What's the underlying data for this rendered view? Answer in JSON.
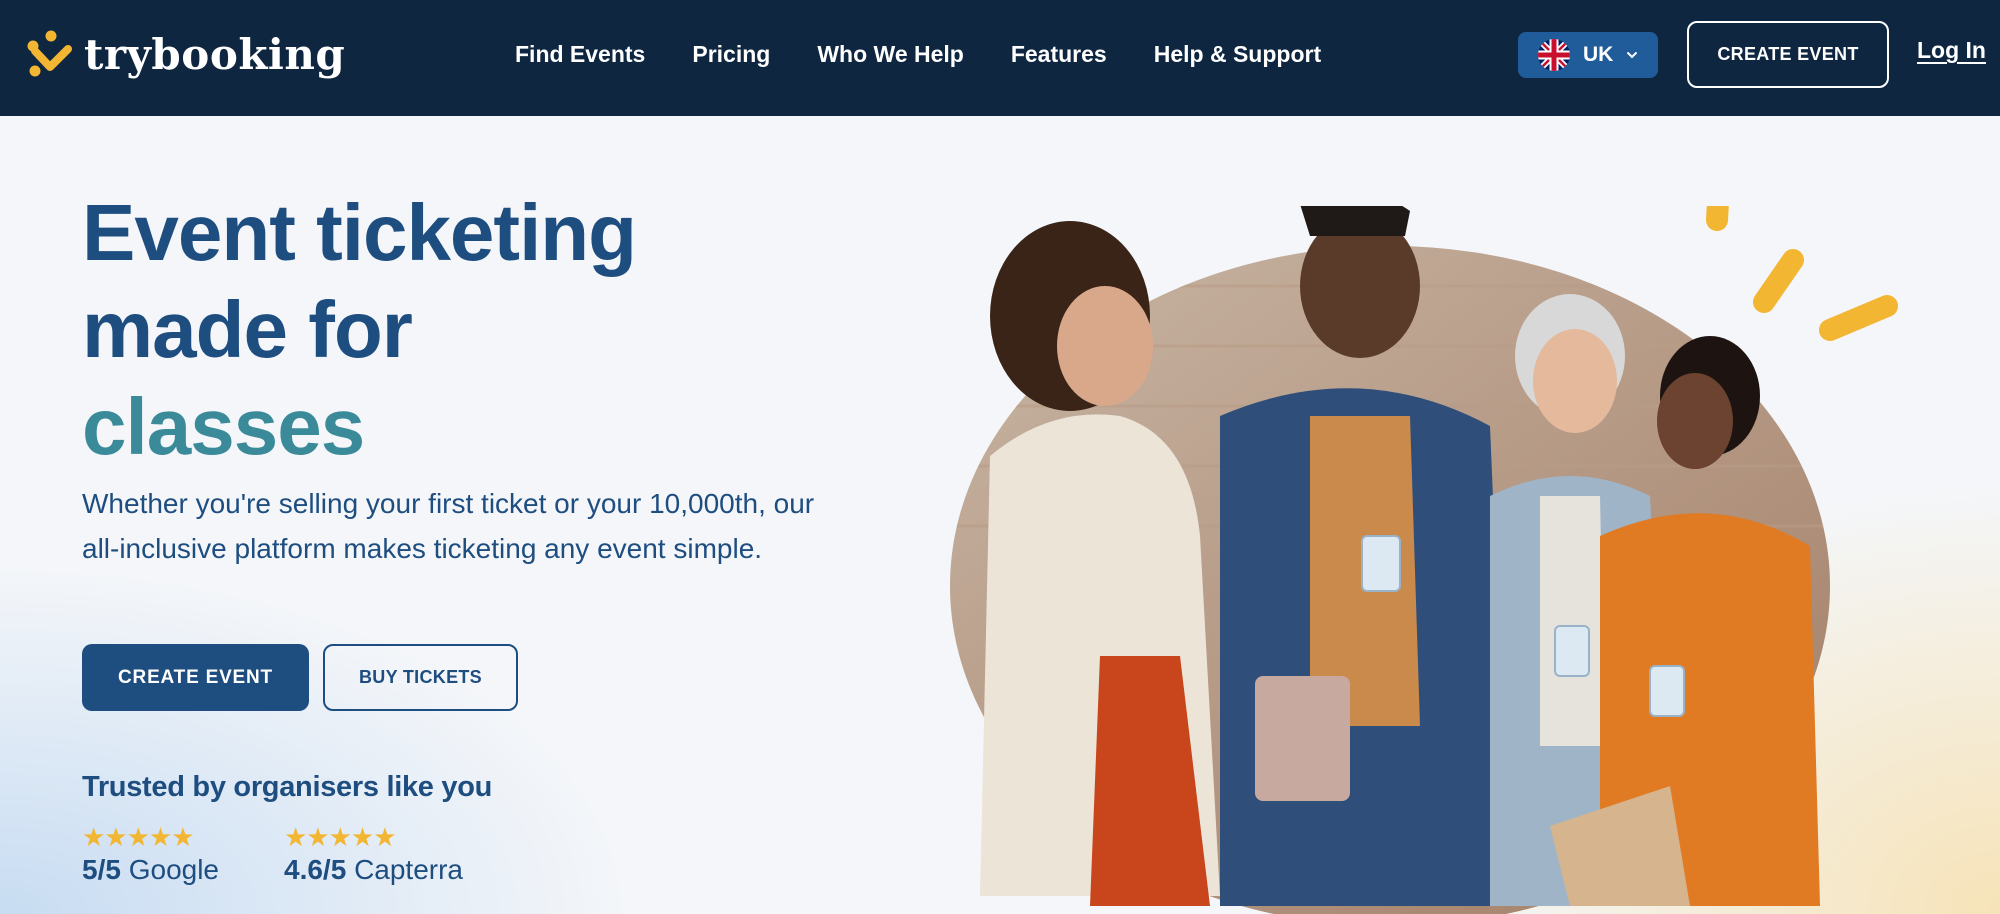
{
  "brand": {
    "name": "trybooking",
    "mark_color": "#f2b632"
  },
  "nav": {
    "links": [
      "Find Events",
      "Pricing",
      "Who We Help",
      "Features",
      "Help & Support"
    ],
    "region": {
      "label": "UK",
      "flag": "uk-flag-icon"
    },
    "cta_label": "CREATE EVENT",
    "login_label": "Log In"
  },
  "hero": {
    "headline": {
      "line1": "Event ticketing",
      "line2": "made for",
      "line3": "classes"
    },
    "subtext": "Whether you're selling your first ticket or your 10,000th, our all-inclusive platform makes ticketing any event simple.",
    "primary_button": "CREATE EVENT",
    "secondary_button": "BUY TICKETS",
    "trusted_title": "Trusted by organisers like you",
    "ratings": [
      {
        "stars": "★★★★★",
        "score": "5/5",
        "source": "Google"
      },
      {
        "stars": "★★★★★",
        "score": "4.6/5",
        "source": "Capterra"
      }
    ]
  },
  "colors": {
    "nav_bg": "#0e2640",
    "primary": "#1e4d80",
    "accent_teal": "#3a8a9a",
    "star": "#f2b632",
    "region_bg": "#1f5c99"
  }
}
